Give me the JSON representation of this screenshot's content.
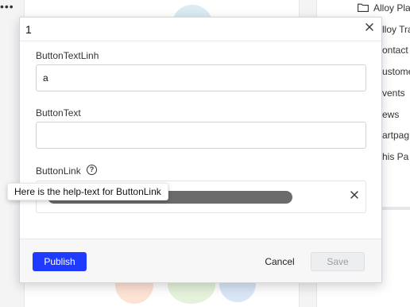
{
  "modal": {
    "title": "1",
    "fields": [
      {
        "label": "ButtonTextLinh",
        "value": "a"
      },
      {
        "label": "ButtonText",
        "value": ""
      },
      {
        "label": "ButtonLink",
        "help_icon_text": "?",
        "tooltip": "Here is the help-text for ButtonLink"
      }
    ],
    "footer": {
      "publish_label": "Publish",
      "cancel_label": "Cancel",
      "save_label": "Save"
    }
  },
  "background": {
    "menu_dots": "•••",
    "tree_items": [
      "Alloy Pla",
      "lloy Tra",
      "ontact",
      "ustome",
      "vents",
      "ews",
      "artpag",
      "his Pa"
    ]
  },
  "colors": {
    "publish_button": "#1f3bff",
    "link_pill": "#6b6b6b"
  }
}
